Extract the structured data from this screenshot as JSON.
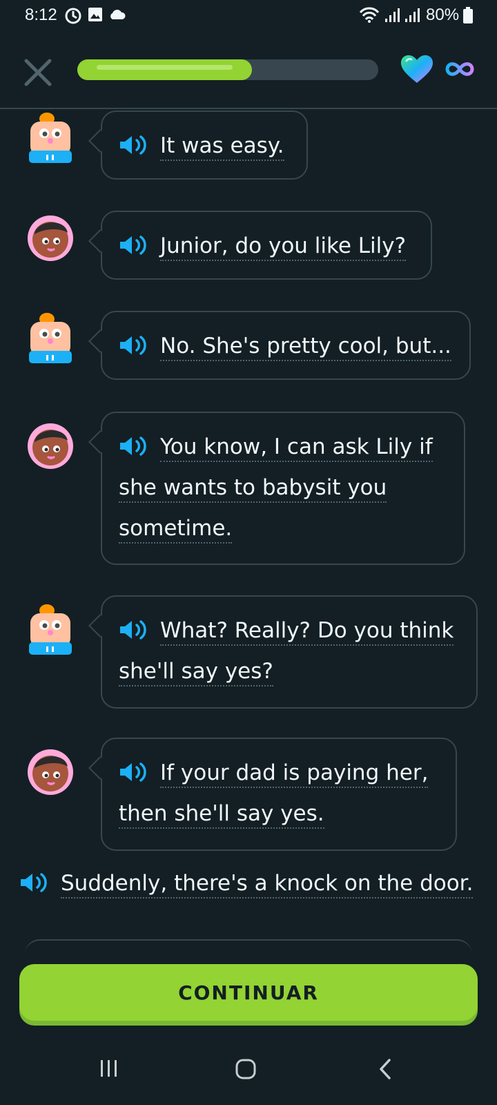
{
  "status_bar": {
    "time": "8:12",
    "battery": "80%"
  },
  "header": {
    "progress": 0.58,
    "hearts": "infinite"
  },
  "messages": [
    {
      "speaker": "junior",
      "lines": [
        "It was easy."
      ]
    },
    {
      "speaker": "woman",
      "lines": [
        "Junior, do you like Lily?"
      ]
    },
    {
      "speaker": "junior",
      "lines": [
        "No. She's pretty cool, but..."
      ]
    },
    {
      "speaker": "woman",
      "lines": [
        "You know, I can ask Lily if",
        "she wants to babysit you",
        "sometime."
      ]
    },
    {
      "speaker": "junior",
      "lines": [
        "What? Really? Do you think",
        "she'll say yes?"
      ]
    },
    {
      "speaker": "woman",
      "lines": [
        "If your dad is paying her,",
        "then she'll say yes."
      ]
    }
  ],
  "narration": "Suddenly, there's a knock on the door.",
  "continue_label": "CONTINUAR",
  "colors": {
    "background": "#131f24",
    "border": "#37464f",
    "accent_green": "#93d333",
    "speaker_blue": "#1cb0f6"
  }
}
